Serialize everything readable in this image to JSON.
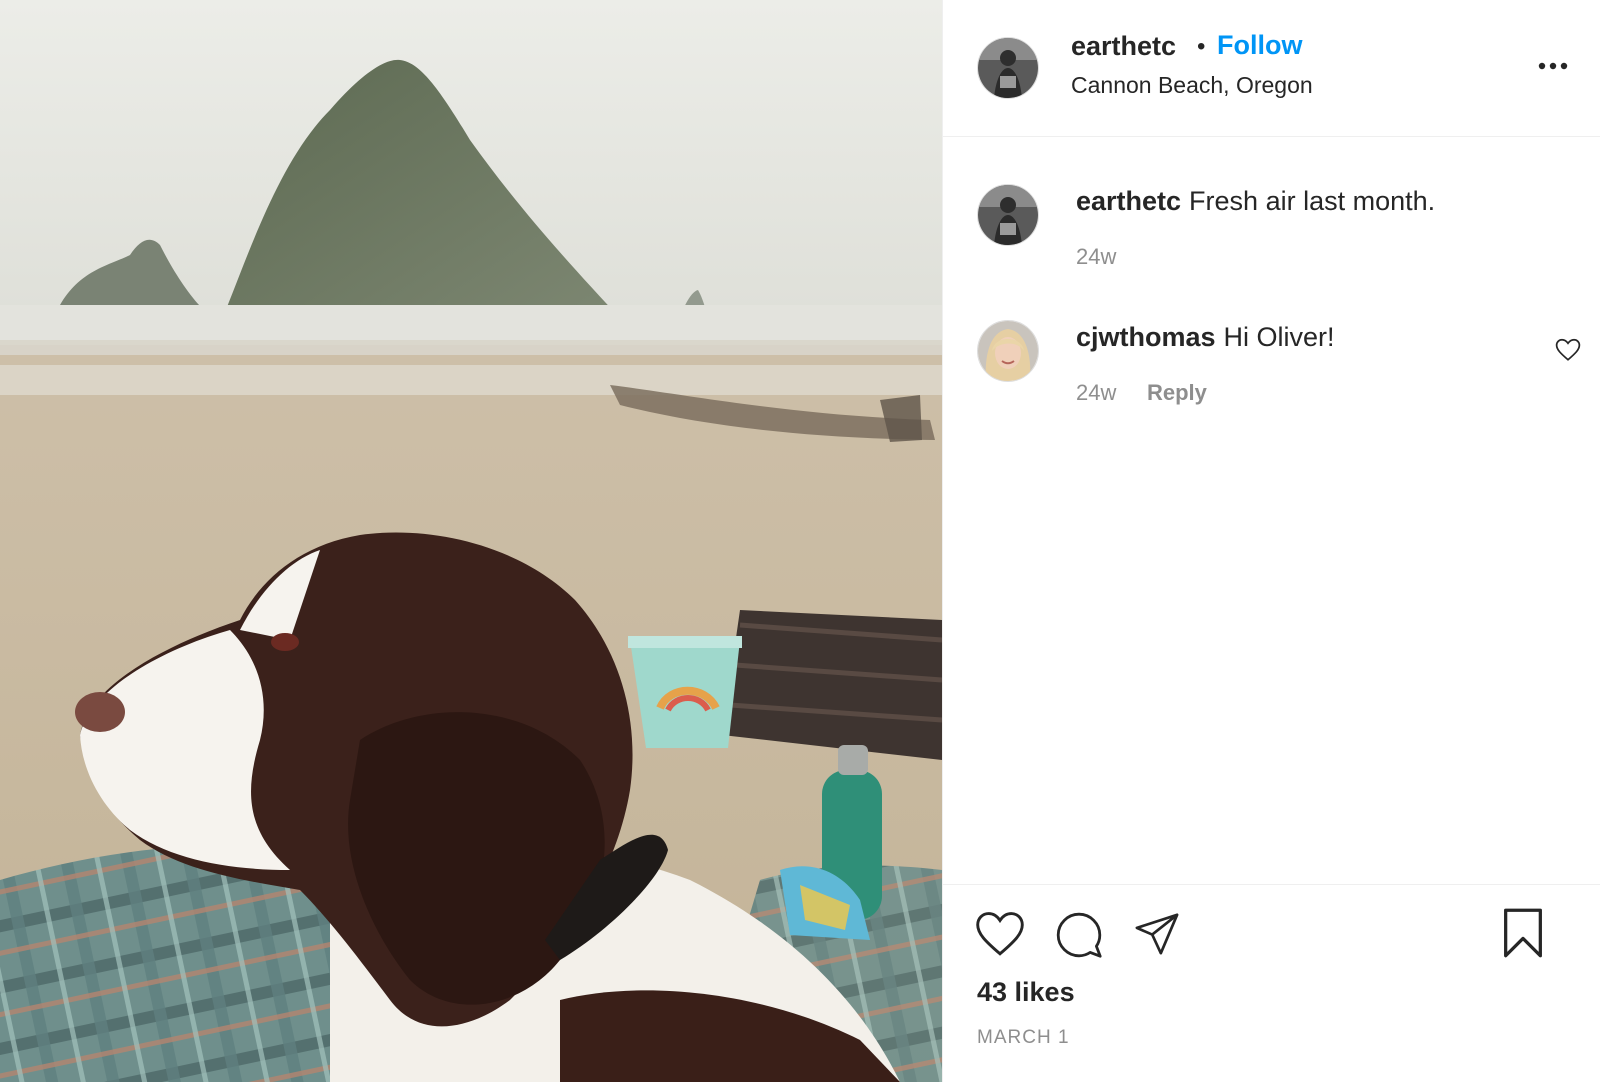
{
  "post": {
    "author": {
      "username": "earthetc",
      "follow_label": "Follow",
      "location": "Cannon Beach, Oregon",
      "separator": "•"
    },
    "more_icon": "more-options-icon",
    "comments": [
      {
        "username": "earthetc",
        "text": "Fresh air last month.",
        "age": "24w"
      },
      {
        "username": "cjwthomas",
        "text": "Hi Oliver!",
        "age": "24w",
        "reply_label": "Reply"
      }
    ],
    "actions": [
      "heart-icon",
      "comment-icon",
      "share-icon",
      "bookmark-icon"
    ],
    "likes": "43 likes",
    "date": "MARCH 1"
  },
  "colors": {
    "accent": "#0095f6",
    "text": "#262626",
    "muted": "#8e8e8e"
  }
}
